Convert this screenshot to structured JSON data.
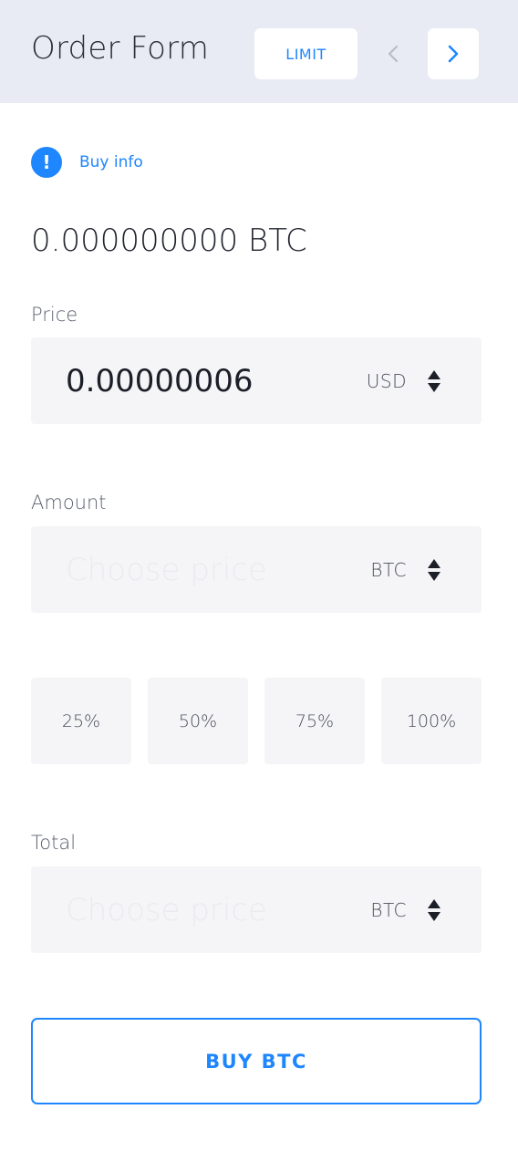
{
  "header": {
    "title": "Order Form",
    "order_type": "LIMIT",
    "prev_icon": "chevron-left-icon",
    "next_icon": "chevron-right-icon"
  },
  "info": {
    "icon": "exclamation-icon",
    "label": "Buy info"
  },
  "balance": "0.000000000 BTC",
  "price": {
    "label": "Price",
    "value": "0.00000006",
    "unit": "USD"
  },
  "amount": {
    "label": "Amount",
    "placeholder": "Choose price",
    "unit": "BTC"
  },
  "percentages": [
    "25%",
    "50%",
    "75%",
    "100%"
  ],
  "total": {
    "label": "Total",
    "placeholder": "Choose price",
    "unit": "BTC"
  },
  "buy_button": "BUY BTC",
  "colors": {
    "accent": "#1e86ff",
    "header_bg": "#e8ebf4",
    "field_bg": "#f5f5f7"
  }
}
